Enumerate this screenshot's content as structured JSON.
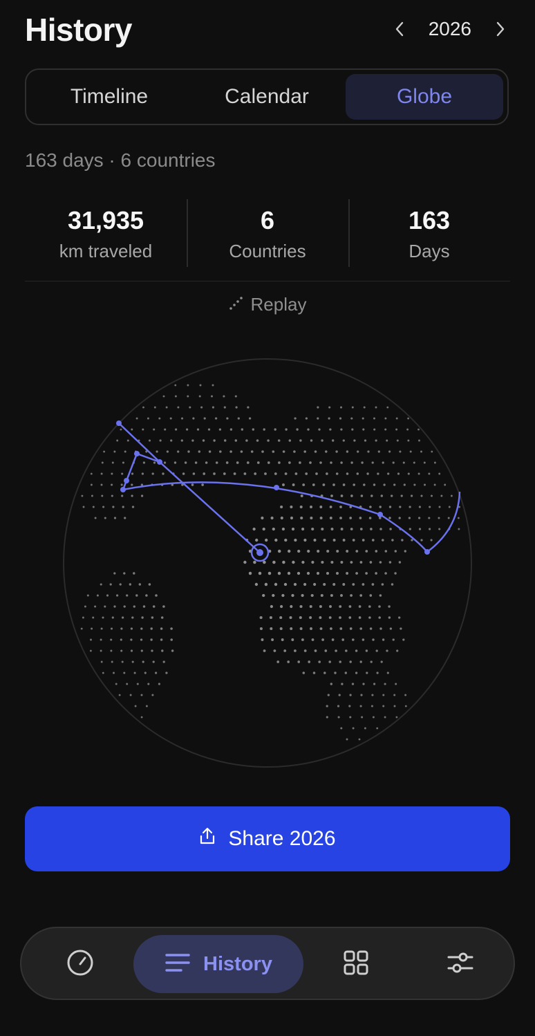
{
  "header": {
    "title": "History",
    "year": "2026"
  },
  "tabs": [
    {
      "label": "Timeline",
      "active": false
    },
    {
      "label": "Calendar",
      "active": false
    },
    {
      "label": "Globe",
      "active": true
    }
  ],
  "summary": "163 days · 6 countries",
  "stats": [
    {
      "value": "31,935",
      "label": "km traveled"
    },
    {
      "value": "6",
      "label": "Countries"
    },
    {
      "value": "163",
      "label": "Days"
    }
  ],
  "replay_label": "Replay",
  "share_label": "Share 2026",
  "bottom_nav": {
    "items": [
      {
        "icon": "speedometer-icon",
        "label": "",
        "active": false
      },
      {
        "icon": "menu-lines-icon",
        "label": "History",
        "active": true
      },
      {
        "icon": "grid-icon",
        "label": "",
        "active": false
      },
      {
        "icon": "sliders-icon",
        "label": "",
        "active": false
      }
    ]
  },
  "colors": {
    "background": "#0f0f0f",
    "accent": "#6b72ee",
    "button": "#2743e3",
    "dots": "#9a9a9a"
  },
  "icons": {
    "prev": "chevron-left-icon",
    "next": "chevron-right-icon",
    "replay": "dotted-path-icon",
    "share": "share-upload-icon"
  }
}
